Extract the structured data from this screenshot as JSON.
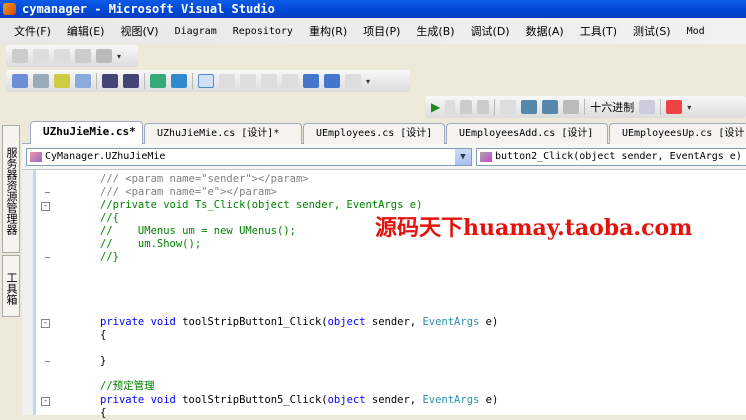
{
  "window": {
    "title": "cymanager - Microsoft Visual Studio"
  },
  "menu": [
    {
      "label": "文件(F)"
    },
    {
      "label": "编辑(E)"
    },
    {
      "label": "视图(V)"
    },
    {
      "label": "Diagram",
      "mono": true
    },
    {
      "label": "Repository",
      "mono": true
    },
    {
      "label": "重构(R)"
    },
    {
      "label": "项目(P)"
    },
    {
      "label": "生成(B)"
    },
    {
      "label": "调试(D)"
    },
    {
      "label": "数据(A)"
    },
    {
      "label": "工具(T)"
    },
    {
      "label": "测试(S)"
    },
    {
      "label": "Mod",
      "mono": true
    }
  ],
  "debug_toolbar": {
    "hex_label": "十六进制"
  },
  "sidebar": {
    "server_explorer": "服务器资源管理器",
    "toolbox": "工具箱"
  },
  "tabs": [
    {
      "label": "UZhuJieMie.cs*",
      "active": true
    },
    {
      "label": "UZhuJieMie.cs [设计]*"
    },
    {
      "label": "UEmployees.cs [设计]"
    },
    {
      "label": "UEmployeesAdd.cs [设计]"
    },
    {
      "label": "UEmployeesUp.cs [设计]"
    }
  ],
  "navbar": {
    "type_dropdown": "CyManager.UZhuJieMie",
    "member_dropdown": "button2_Click(object sender, EventArgs e)"
  },
  "code": {
    "l0": "/// <param name=\"sender\"></param>",
    "l1": "/// <param name=\"e\"></param>",
    "l2": "//private void Ts_Click(object sender, EventArgs e)",
    "l3": "//{",
    "l4": "//    UMenus um = new UMenus();",
    "l5": "//    um.Show();",
    "l6": "//}",
    "kw_private": "private",
    "kw_void": "void",
    "kw_object": "object",
    "m1": " toolStripButton1_Click(",
    "m5": " toolStripButton5_Click(",
    "sender": " sender, ",
    "type": "EventArgs",
    "end": " e)",
    "open": "{",
    "close": "}",
    "l16": "//预定管理"
  },
  "watermark": "源码天下huamay.taoba.com"
}
